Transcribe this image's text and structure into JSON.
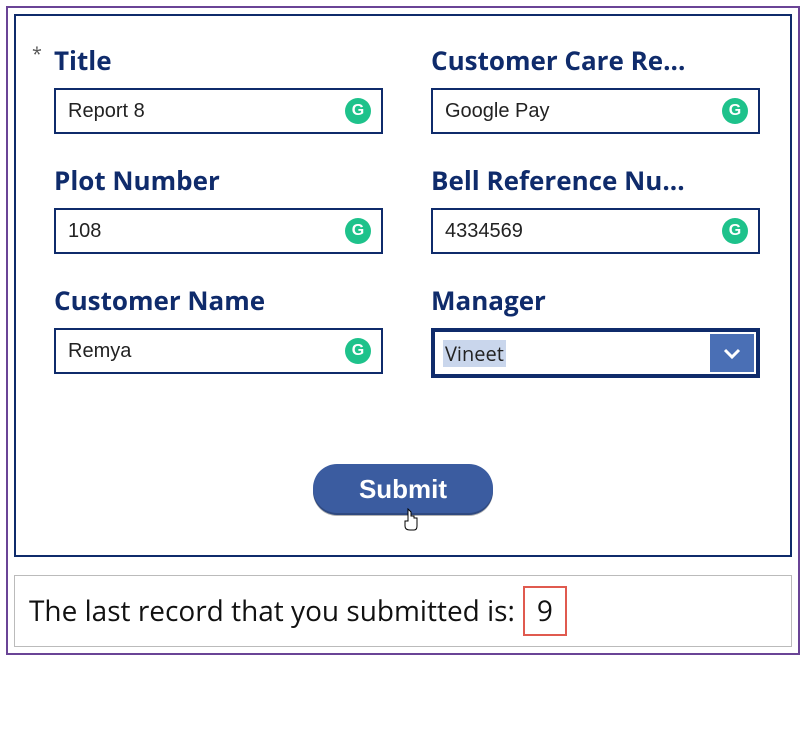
{
  "form": {
    "title": {
      "label": "Title",
      "value": "Report 8"
    },
    "customer_care": {
      "label": "Customer Care Re...",
      "value": "Google Pay"
    },
    "plot_number": {
      "label": "Plot Number",
      "value": "108"
    },
    "bell_ref": {
      "label": "Bell Reference Nu...",
      "value": "4334569"
    },
    "customer_name": {
      "label": "Customer Name",
      "value": "Remya"
    },
    "manager": {
      "label": "Manager",
      "selected": "Vineet"
    },
    "submit_label": "Submit"
  },
  "status": {
    "prefix": "The last record that you submitted is:",
    "value": "9"
  },
  "icons": {
    "grammarly_glyph": "G"
  }
}
